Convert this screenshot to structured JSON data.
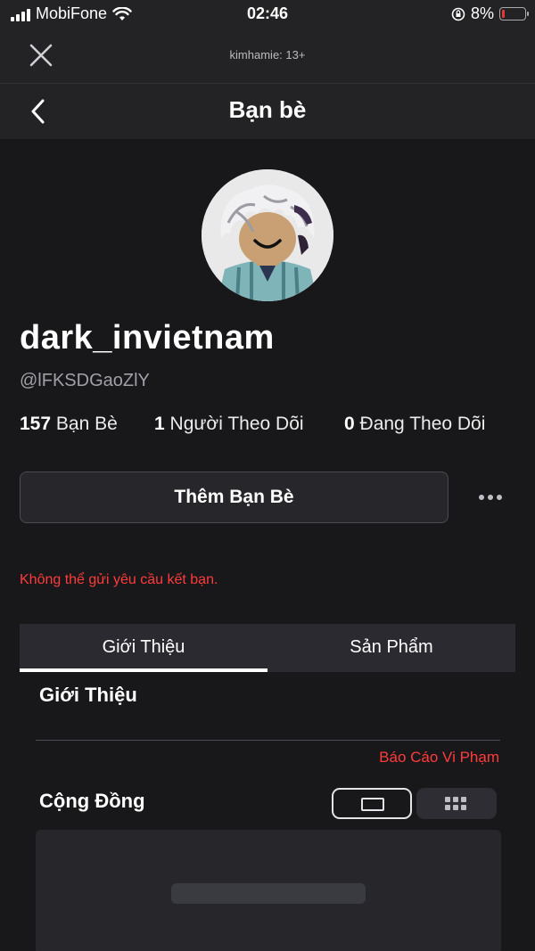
{
  "status_bar": {
    "carrier": "MobiFone",
    "time": "02:46",
    "battery_percent": "8%",
    "battery_level": 0.08,
    "battery_color": "#e53935"
  },
  "top_bar": {
    "account_label": "kimhamie: 13+",
    "close_icon": "close-icon"
  },
  "nav": {
    "title": "Bạn bè",
    "back_icon": "chevron-left-icon"
  },
  "profile": {
    "display_name": "dark_invietnam",
    "handle": "@lFKSDGaoZlY",
    "stats": {
      "friends_count": "157",
      "friends_label": "Bạn Bè",
      "followers_count": "1",
      "followers_label": "Người Theo Dõi",
      "following_count": "0",
      "following_label": "Đang Theo Dõi"
    },
    "add_friend_label": "Thêm Bạn Bè",
    "error_message": "Không thể gửi yêu cầu kết bạn."
  },
  "tabs": [
    {
      "label": "Giới Thiệu",
      "active": true
    },
    {
      "label": "Sản Phẩm",
      "active": false
    }
  ],
  "about": {
    "heading": "Giới Thiệu",
    "report_label": "Báo Cáo Vi Phạm"
  },
  "community": {
    "heading": "Cộng Đồng",
    "view_modes": [
      "list-view-icon",
      "grid-view-icon"
    ],
    "selected_view": "list"
  },
  "colors": {
    "background": "#18181b",
    "bar": "#232326",
    "error": "#ff3b3b",
    "button": "#26262b"
  }
}
